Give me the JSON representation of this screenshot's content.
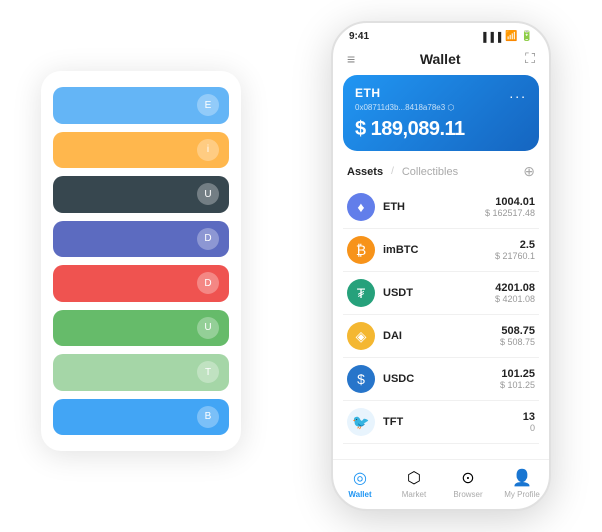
{
  "bgCard": {
    "rows": [
      {
        "color": "#64B5F6",
        "iconText": "E"
      },
      {
        "color": "#FFB74D",
        "iconText": "i"
      },
      {
        "color": "#37474F",
        "iconText": "U"
      },
      {
        "color": "#5C6BC0",
        "iconText": "D"
      },
      {
        "color": "#EF5350",
        "iconText": "D"
      },
      {
        "color": "#66BB6A",
        "iconText": "U"
      },
      {
        "color": "#A5D6A7",
        "iconText": "T"
      },
      {
        "color": "#42A5F5",
        "iconText": "B"
      }
    ]
  },
  "statusBar": {
    "time": "9:41",
    "signal": "▐▐▐",
    "wifi": "◗",
    "battery": "▓"
  },
  "header": {
    "menuIcon": "≡",
    "title": "Wallet",
    "expandIcon": "⛶"
  },
  "walletCard": {
    "ticker": "ETH",
    "address": "0x08711d3b...8418a78e3 ⬡",
    "amount": "$ 189,089.11",
    "moreIcon": "..."
  },
  "assetsSection": {
    "activeTab": "Assets",
    "divider": "/",
    "inactiveTab": "Collectibles",
    "addIcon": "⊕"
  },
  "assets": [
    {
      "name": "ETH",
      "amount": "1004.01",
      "usd": "$ 162517.48",
      "iconBg": "#627eea",
      "iconText": "♦",
      "iconColor": "#ffffff"
    },
    {
      "name": "imBTC",
      "amount": "2.5",
      "usd": "$ 21760.1",
      "iconBg": "#f7931a",
      "iconText": "₿",
      "iconColor": "#ffffff"
    },
    {
      "name": "USDT",
      "amount": "4201.08",
      "usd": "$ 4201.08",
      "iconBg": "#26a17b",
      "iconText": "₮",
      "iconColor": "#ffffff"
    },
    {
      "name": "DAI",
      "amount": "508.75",
      "usd": "$ 508.75",
      "iconBg": "#f4b731",
      "iconText": "◈",
      "iconColor": "#ffffff"
    },
    {
      "name": "USDC",
      "amount": "101.25",
      "usd": "$ 101.25",
      "iconBg": "#2775ca",
      "iconText": "$",
      "iconColor": "#ffffff"
    },
    {
      "name": "TFT",
      "amount": "13",
      "usd": "0",
      "iconBg": "#e8f4fd",
      "iconText": "🐦",
      "iconColor": "#2196f3"
    }
  ],
  "bottomNav": [
    {
      "label": "Wallet",
      "icon": "◎",
      "active": true
    },
    {
      "label": "Market",
      "icon": "⬡",
      "active": false
    },
    {
      "label": "Browser",
      "icon": "⊙",
      "active": false
    },
    {
      "label": "My Profile",
      "icon": "👤",
      "active": false
    }
  ]
}
